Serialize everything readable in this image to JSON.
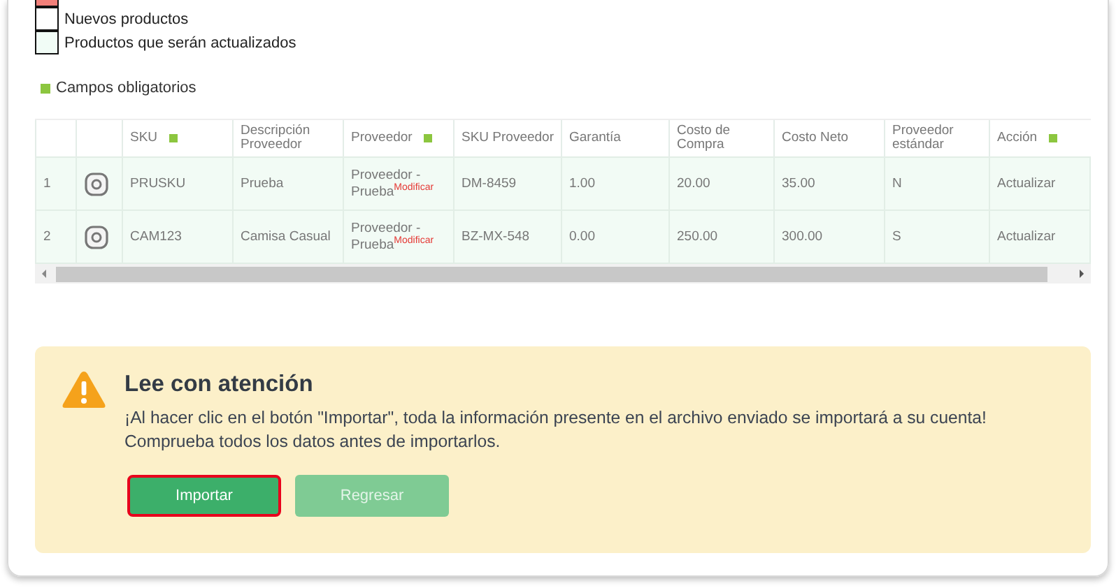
{
  "legend": [
    {
      "kind": "error"
    },
    {
      "kind": "new",
      "label": "Nuevos productos"
    },
    {
      "kind": "update",
      "label": "Productos que serán actualizados"
    }
  ],
  "required_note": "Campos obligatorios",
  "table": {
    "columns": [
      {
        "required": false
      },
      {
        "required": false
      },
      {
        "label": "SKU",
        "required": true
      },
      {
        "label": "Descripción Proveedor",
        "required": false
      },
      {
        "label": "Proveedor",
        "required": true
      },
      {
        "label": "SKU Proveedor",
        "required": false
      },
      {
        "label": "Garantía",
        "required": false
      },
      {
        "label": "Costo de Compra",
        "required": false
      },
      {
        "label": "Costo Neto",
        "required": false
      },
      {
        "label": "Proveedor estándar",
        "required": false
      },
      {
        "label": "Acción",
        "required": true
      }
    ],
    "rows": [
      {
        "index": "1",
        "sku": "PRUSKU",
        "description": "Prueba",
        "provider": "Proveedor - Prueba",
        "provider_tag": "Modificar",
        "provider_sku": "DM-8459",
        "warranty": "1.00",
        "purchase_cost": "20.00",
        "net_cost": "35.00",
        "standard_provider": "N",
        "action": "Actualizar"
      },
      {
        "index": "2",
        "sku": "CAM123",
        "description": "Camisa Casual",
        "provider": "Proveedor - Prueba",
        "provider_tag": "Modificar",
        "provider_sku": "BZ-MX-548",
        "warranty": "0.00",
        "purchase_cost": "250.00",
        "net_cost": "300.00",
        "standard_provider": "S",
        "action": "Actualizar"
      }
    ]
  },
  "notice": {
    "title": "Lee con atención",
    "lines": [
      "¡Al hacer clic en el botón \"Importar\", toda la información presente en el archivo enviado se importará a su cuenta!",
      "Comprueba todos los datos antes de importarlos."
    ]
  },
  "buttons": [
    {
      "label": "Importar",
      "highlighted": true,
      "disabled": false
    },
    {
      "label": "Regresar",
      "highlighted": false,
      "disabled": true
    }
  ]
}
